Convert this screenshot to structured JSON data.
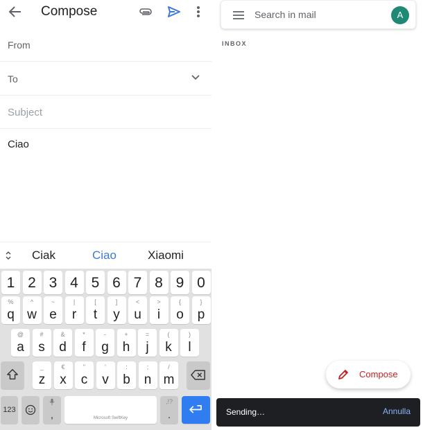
{
  "compose": {
    "title": "Compose",
    "icons": {
      "back": "arrow-left",
      "attach": "paperclip",
      "send": "send-triangle",
      "more": "vertical-dots"
    },
    "from_label": "From",
    "to_label": "To",
    "subject_placeholder": "Subject",
    "body": "Ciao"
  },
  "suggestions": [
    "Ciak",
    "Ciao",
    "Xiaomi"
  ],
  "keyboard": {
    "numbers": [
      "1",
      "2",
      "3",
      "4",
      "5",
      "6",
      "7",
      "8",
      "9",
      "0"
    ],
    "row1": [
      {
        "key": "q",
        "alt": "%"
      },
      {
        "key": "w",
        "alt": "^"
      },
      {
        "key": "e",
        "alt": "~"
      },
      {
        "key": "r",
        "alt": "|"
      },
      {
        "key": "t",
        "alt": "["
      },
      {
        "key": "y",
        "alt": "]"
      },
      {
        "key": "u",
        "alt": "<"
      },
      {
        "key": "i",
        "alt": ">"
      },
      {
        "key": "o",
        "alt": "{"
      },
      {
        "key": "p",
        "alt": "}"
      }
    ],
    "row2": [
      {
        "key": "a",
        "alt": "@"
      },
      {
        "key": "s",
        "alt": "#"
      },
      {
        "key": "d",
        "alt": "&"
      },
      {
        "key": "f",
        "alt": "*"
      },
      {
        "key": "g",
        "alt": "-"
      },
      {
        "key": "h",
        "alt": "+"
      },
      {
        "key": "j",
        "alt": "="
      },
      {
        "key": "k",
        "alt": "("
      },
      {
        "key": "l",
        "alt": ")"
      }
    ],
    "row3": [
      {
        "key": "z",
        "alt": "_"
      },
      {
        "key": "x",
        "alt": "€"
      },
      {
        "key": "c",
        "alt": "\""
      },
      {
        "key": "v",
        "alt": "'"
      },
      {
        "key": "b",
        "alt": ":"
      },
      {
        "key": "n",
        "alt": ";"
      },
      {
        "key": "m",
        "alt": "/"
      }
    ],
    "symbols_key": "123",
    "comma_key": ",",
    "period_key": ".",
    "period_alt": ",!?",
    "space_label": "Microsoft SwiftKey"
  },
  "inbox": {
    "search_placeholder": "Search in mail",
    "avatar_letter": "A",
    "avatar_color": "#1e8a76",
    "section_label": "INBOX",
    "fab_label": "Compose",
    "fab_color": "#c5221f",
    "snackbar_text": "Sending…",
    "snackbar_action": "Annulla",
    "snackbar_action_color": "#8ab4f8"
  }
}
